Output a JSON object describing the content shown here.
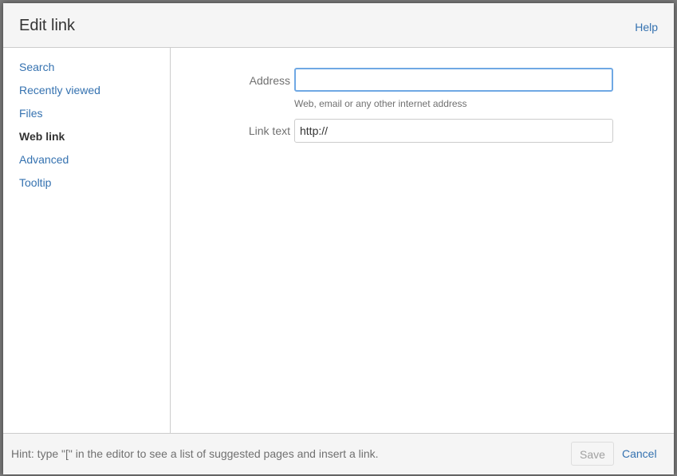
{
  "dialog": {
    "title": "Edit link",
    "help_label": "Help"
  },
  "sidebar": {
    "items": [
      {
        "label": "Search",
        "active": false
      },
      {
        "label": "Recently viewed",
        "active": false
      },
      {
        "label": "Files",
        "active": false
      },
      {
        "label": "Web link",
        "active": true
      },
      {
        "label": "Advanced",
        "active": false
      },
      {
        "label": "Tooltip",
        "active": false
      }
    ]
  },
  "form": {
    "address": {
      "label": "Address",
      "value": "",
      "description": "Web, email or any other internet address"
    },
    "link_text": {
      "label": "Link text",
      "value": "http://"
    }
  },
  "footer": {
    "hint": "Hint: type \"[\" in the editor to see a list of suggested pages and insert a link.",
    "save_label": "Save",
    "cancel_label": "Cancel"
  },
  "colors": {
    "link": "#3572b0",
    "focus_border": "#6fa8e4",
    "header_bg": "#f5f5f5"
  }
}
